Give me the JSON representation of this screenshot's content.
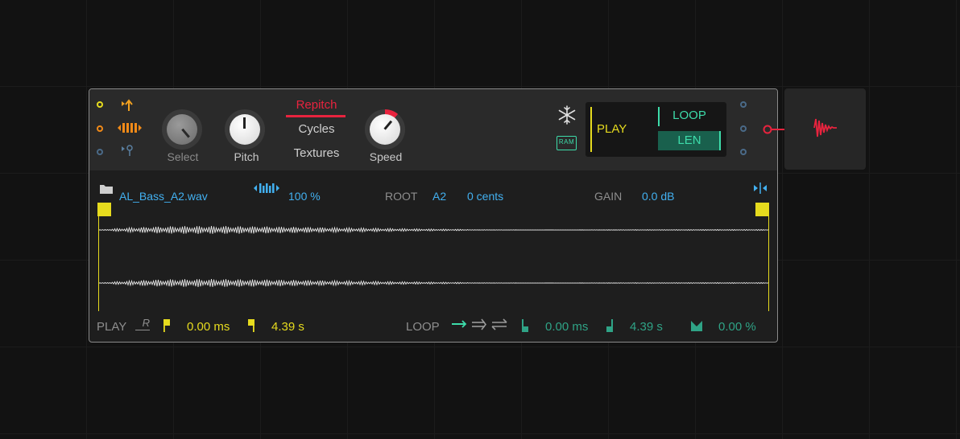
{
  "device": {
    "knobs": {
      "select": "Select",
      "pitch": "Pitch",
      "speed": "Speed"
    },
    "modes": [
      "Repitch",
      "Cycles",
      "Textures"
    ],
    "play_panel": {
      "play": "PLAY",
      "loop": "LOOP",
      "len": "LEN",
      "ram": "RAM"
    },
    "sample": {
      "file": "AL_Bass_A2.wav",
      "speed_percent": "100 %",
      "root_label": "ROOT",
      "root_note": "A2",
      "cents": "0 cents",
      "gain_label": "GAIN",
      "gain_value": "0.0 dB"
    },
    "footer": {
      "play_label": "PLAY",
      "r_label": "R",
      "play_start": "0.00 ms",
      "play_end": "4.39 s",
      "loop_label": "LOOP",
      "loop_start": "0.00 ms",
      "loop_end": "4.39 s",
      "crossfade": "0.00 %"
    }
  },
  "colors": {
    "accent_red": "#e8233e",
    "play_yellow": "#e6db1e",
    "loop_teal": "#3ddcaa",
    "value_blue": "#42b0f0",
    "midi_orange": "#f08a18"
  },
  "icons": [
    "folder-icon",
    "snowflake-icon",
    "ram-icon",
    "speed-stretch-icon",
    "fit-icon",
    "flag-icon",
    "sampler-icon"
  ]
}
